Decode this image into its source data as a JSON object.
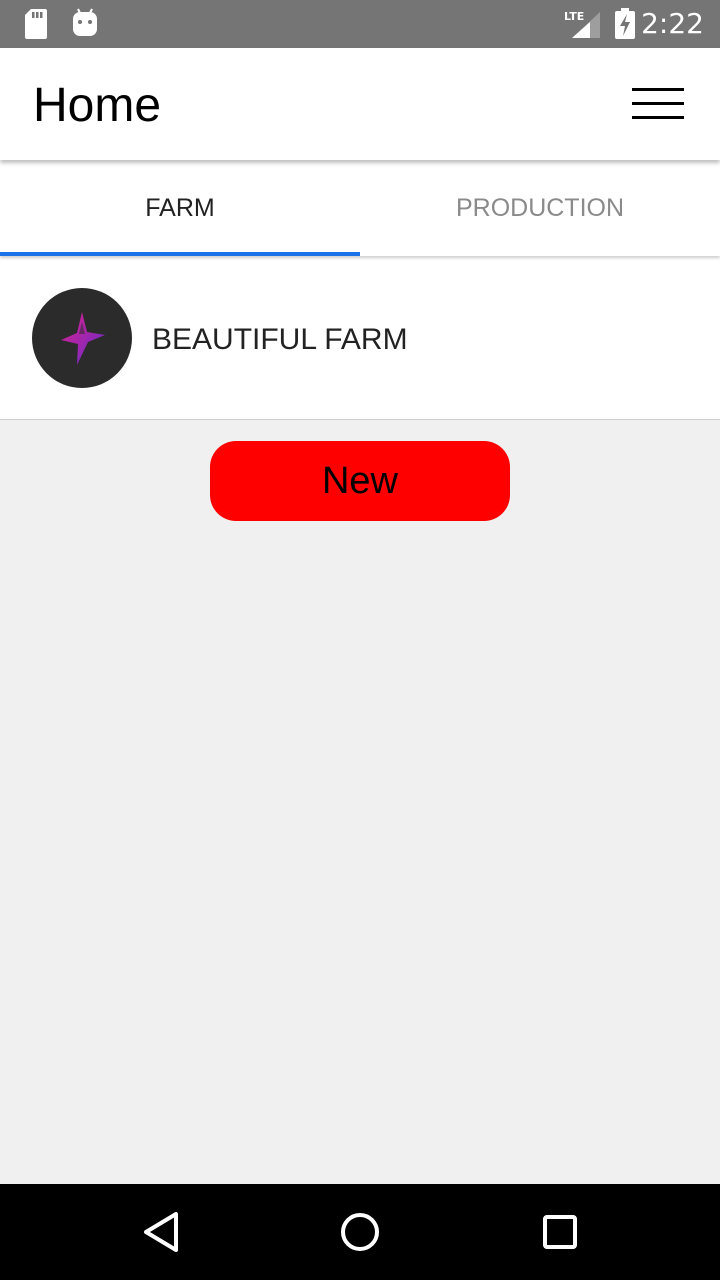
{
  "status_bar": {
    "time": "2:22",
    "network": "LTE",
    "icons": [
      "sd-card-icon",
      "android-icon",
      "lte-signal-icon",
      "battery-charging-icon"
    ]
  },
  "app_bar": {
    "title": "Home",
    "menu_icon": "hamburger-menu-icon"
  },
  "tabs": [
    {
      "label": "FARM",
      "active": true
    },
    {
      "label": "PRODUCTION",
      "active": false
    }
  ],
  "farm_list": [
    {
      "name": "BEAUTIFUL FARM",
      "avatar_icon": "star-logo-icon"
    }
  ],
  "new_button": {
    "label": "New"
  },
  "nav_bar": {
    "icons": [
      "back-triangle-icon",
      "home-circle-icon",
      "recents-square-icon"
    ]
  },
  "colors": {
    "status_bar": "#757575",
    "tab_indicator": "#1a73e8",
    "new_button": "#ff0000",
    "background": "#f0f0f0",
    "avatar_bg": "#2b2b2b"
  }
}
